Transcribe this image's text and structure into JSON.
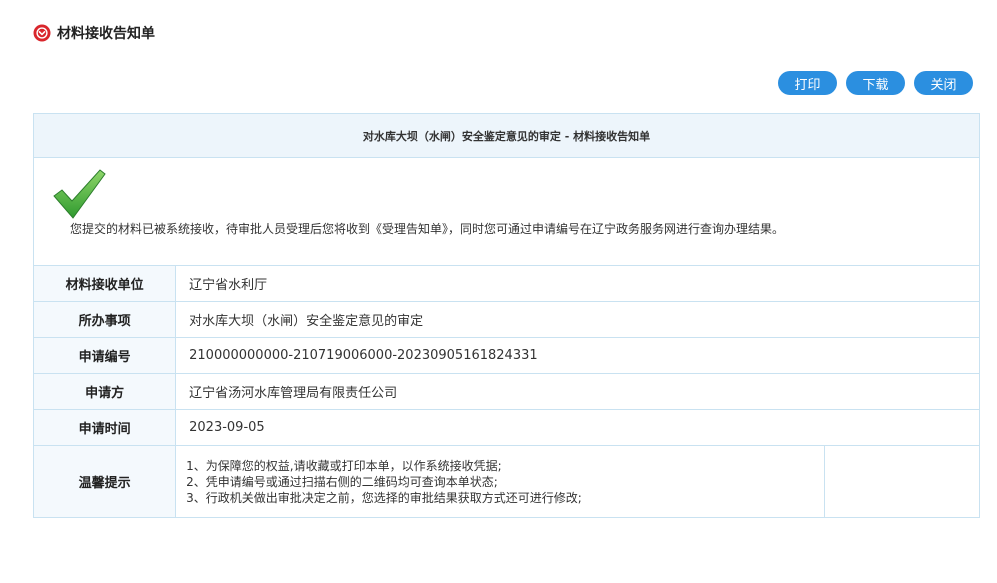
{
  "header": {
    "title": "材料接收告知单"
  },
  "toolbar": {
    "print_label": "打印",
    "download_label": "下载",
    "close_label": "关闭"
  },
  "form": {
    "caption": "对水库大坝（水闸）安全鉴定意见的审定 - 材料接收告知单",
    "notice": "您提交的材料已被系统接收，待审批人员受理后您将收到《受理告知单》，同时您可通过申请编号在辽宁政务服务网进行查询办理结果。",
    "rows": [
      {
        "label": "材料接收单位",
        "value": "辽宁省水利厅"
      },
      {
        "label": "所办事项",
        "value": "对水库大坝（水闸）安全鉴定意见的审定"
      },
      {
        "label": "申请编号",
        "value": "210000000000-210719006000-20230905161824331"
      },
      {
        "label": "申请方",
        "value": "辽宁省汤河水库管理局有限责任公司"
      },
      {
        "label": "申请时间",
        "value": "2023-09-05"
      }
    ],
    "tips": {
      "label": "温馨提示",
      "lines": [
        "1、为保障您的权益,请收藏或打印本单，以作系统接收凭据;",
        "2、凭申请编号或通过扫描右侧的二维码均可查询本单状态;",
        "3、行政机关做出审批决定之前，您选择的审批结果获取方式还可进行修改;"
      ]
    }
  },
  "icons": {
    "header_icon": "red-circle-chevron-icon",
    "check_icon": "green-checkmark-icon"
  },
  "colors": {
    "accent": "#2b8fe0",
    "border": "#c9e2f1",
    "caption_bg": "#edf5fb",
    "header_icon": "#d9262c",
    "check": "#3aa33a"
  }
}
